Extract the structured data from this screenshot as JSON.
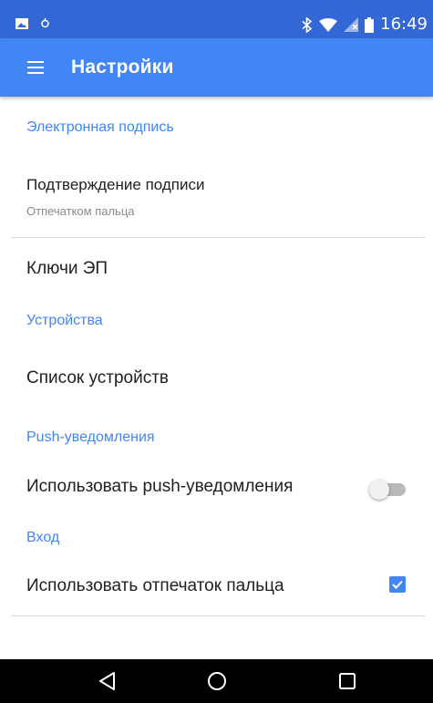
{
  "status_bar": {
    "time": "16:49",
    "icons": [
      "image-icon",
      "alarm-icon",
      "bluetooth-icon",
      "wifi-icon",
      "signal-icon",
      "battery-icon"
    ]
  },
  "app_bar": {
    "title": "Настройки",
    "menu_icon": "hamburger-menu-icon",
    "color": "#4285f4"
  },
  "sections": {
    "signature": {
      "header": "Электронная подпись",
      "confirm_title": "Подтверждение подписи",
      "confirm_summary": "Отпечатком пальца",
      "keys_title": "Ключи ЭП"
    },
    "devices": {
      "header": "Устройства",
      "list_title": "Список устройств"
    },
    "push": {
      "header": "Push-уведомления",
      "use_title": "Использовать push-уведомления",
      "enabled": false
    },
    "login": {
      "header": "Вход",
      "fingerprint_title": "Использовать отпечаток пальца",
      "checked": true
    }
  },
  "nav_bar": {
    "back_icon": "back-triangle-icon",
    "home_icon": "home-circle-icon",
    "recents_icon": "recents-square-icon"
  }
}
